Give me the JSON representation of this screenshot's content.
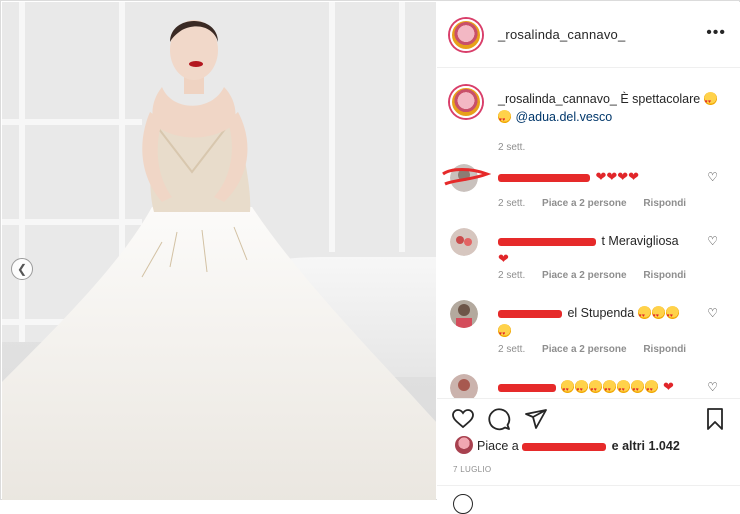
{
  "post": {
    "username": "_rosalinda_cannavo_",
    "more_icon": "more-icon",
    "caption": {
      "username": "_rosalinda_cannavo_",
      "text": "È spettacolare",
      "mention": "@adua.del.vesco",
      "time": "2 sett."
    },
    "comments": [
      {
        "text": "",
        "hearts": 4,
        "time": "2 sett.",
        "likes": "Piace a 2 persone",
        "reply": "Rispondi"
      },
      {
        "text": "t Meravigliosa",
        "time": "2 sett.",
        "likes": "Piace a 2 persone",
        "reply": "Rispondi"
      },
      {
        "text": "el Stupenda",
        "time": "2 sett.",
        "likes": "Piace a 2 persone",
        "reply": "Rispondi"
      },
      {
        "text": "",
        "time": "",
        "likes": "",
        "reply": ""
      }
    ],
    "likes_prefix": "Piace a",
    "likes_suffix": "e altri 1.042",
    "date": "7 LUGLIO"
  },
  "colors": {
    "accent": "#00376b",
    "redaction": "#e62a2a",
    "meta": "#8e8e8e"
  }
}
